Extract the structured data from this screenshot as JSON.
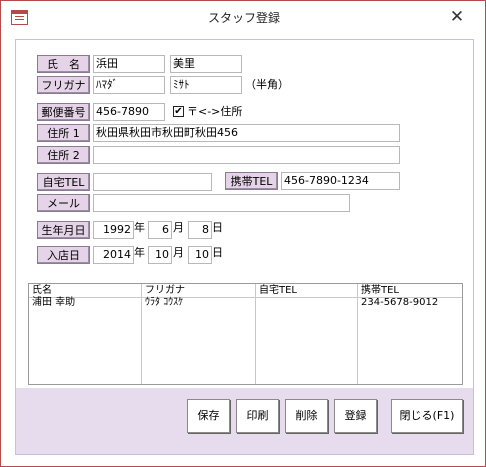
{
  "window": {
    "title": "スタッフ登録",
    "close_label": "✕"
  },
  "form": {
    "name_label": "氏　名",
    "last_name": "浜田",
    "first_name": "美里",
    "kana_label": "フリガナ",
    "last_kana": "ﾊﾏﾀﾞ",
    "first_kana": "ﾐｻﾄ",
    "kana_note": "（半角）",
    "postal_label": "郵便番号",
    "postal_code": "456-7890",
    "auto_address_checked": true,
    "auto_address_label": "〒<->住所",
    "address1_label": "住所 1",
    "address1": "秋田県秋田市秋田町秋田456",
    "address2_label": "住所 2",
    "address2": "",
    "home_tel_label": "自宅TEL",
    "home_tel": "",
    "mobile_tel_label": "携帯TEL",
    "mobile_tel": "456-7890-1234",
    "email_label": "メール",
    "email": "",
    "birth_label": "生年月日",
    "birth_year": "1992",
    "birth_month": "6",
    "birth_day": "8",
    "join_label": "入店日",
    "join_year": "2014",
    "join_month": "10",
    "join_day": "10",
    "year_unit": "年",
    "month_unit": "月",
    "day_unit": "日"
  },
  "list": {
    "headers": [
      "氏名",
      "フリガナ",
      "自宅TEL",
      "携帯TEL"
    ],
    "rows": [
      {
        "name": "浦田 幸助",
        "kana": "ｳﾗﾀ ｺｳｽｹ",
        "home_tel": "",
        "mobile_tel": "234-5678-9012"
      }
    ]
  },
  "buttons": {
    "save": "保存",
    "print": "印刷",
    "delete": "削除",
    "register": "登録",
    "close": "閉じる(F1)"
  },
  "colors": {
    "label_bg": "#e5d4e8",
    "footer_bg": "#e6dcee",
    "window_border": "#b44a4a"
  }
}
